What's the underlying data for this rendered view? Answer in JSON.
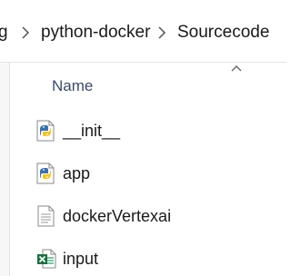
{
  "breadcrumb": {
    "items": [
      "g",
      "python-docker",
      "Sourcecode"
    ]
  },
  "column_header": {
    "name_label": "Name",
    "sort": "ascending"
  },
  "files": [
    {
      "name": "__init__",
      "icon": "python-file-icon"
    },
    {
      "name": "app",
      "icon": "python-file-icon"
    },
    {
      "name": "dockerVertexai",
      "icon": "text-file-icon"
    },
    {
      "name": "input",
      "icon": "excel-file-icon"
    }
  ],
  "colors": {
    "header_text": "#3b4a6b",
    "python_blue": "#3a72b0",
    "python_yellow": "#f5c518",
    "excel_green": "#1d7044"
  }
}
